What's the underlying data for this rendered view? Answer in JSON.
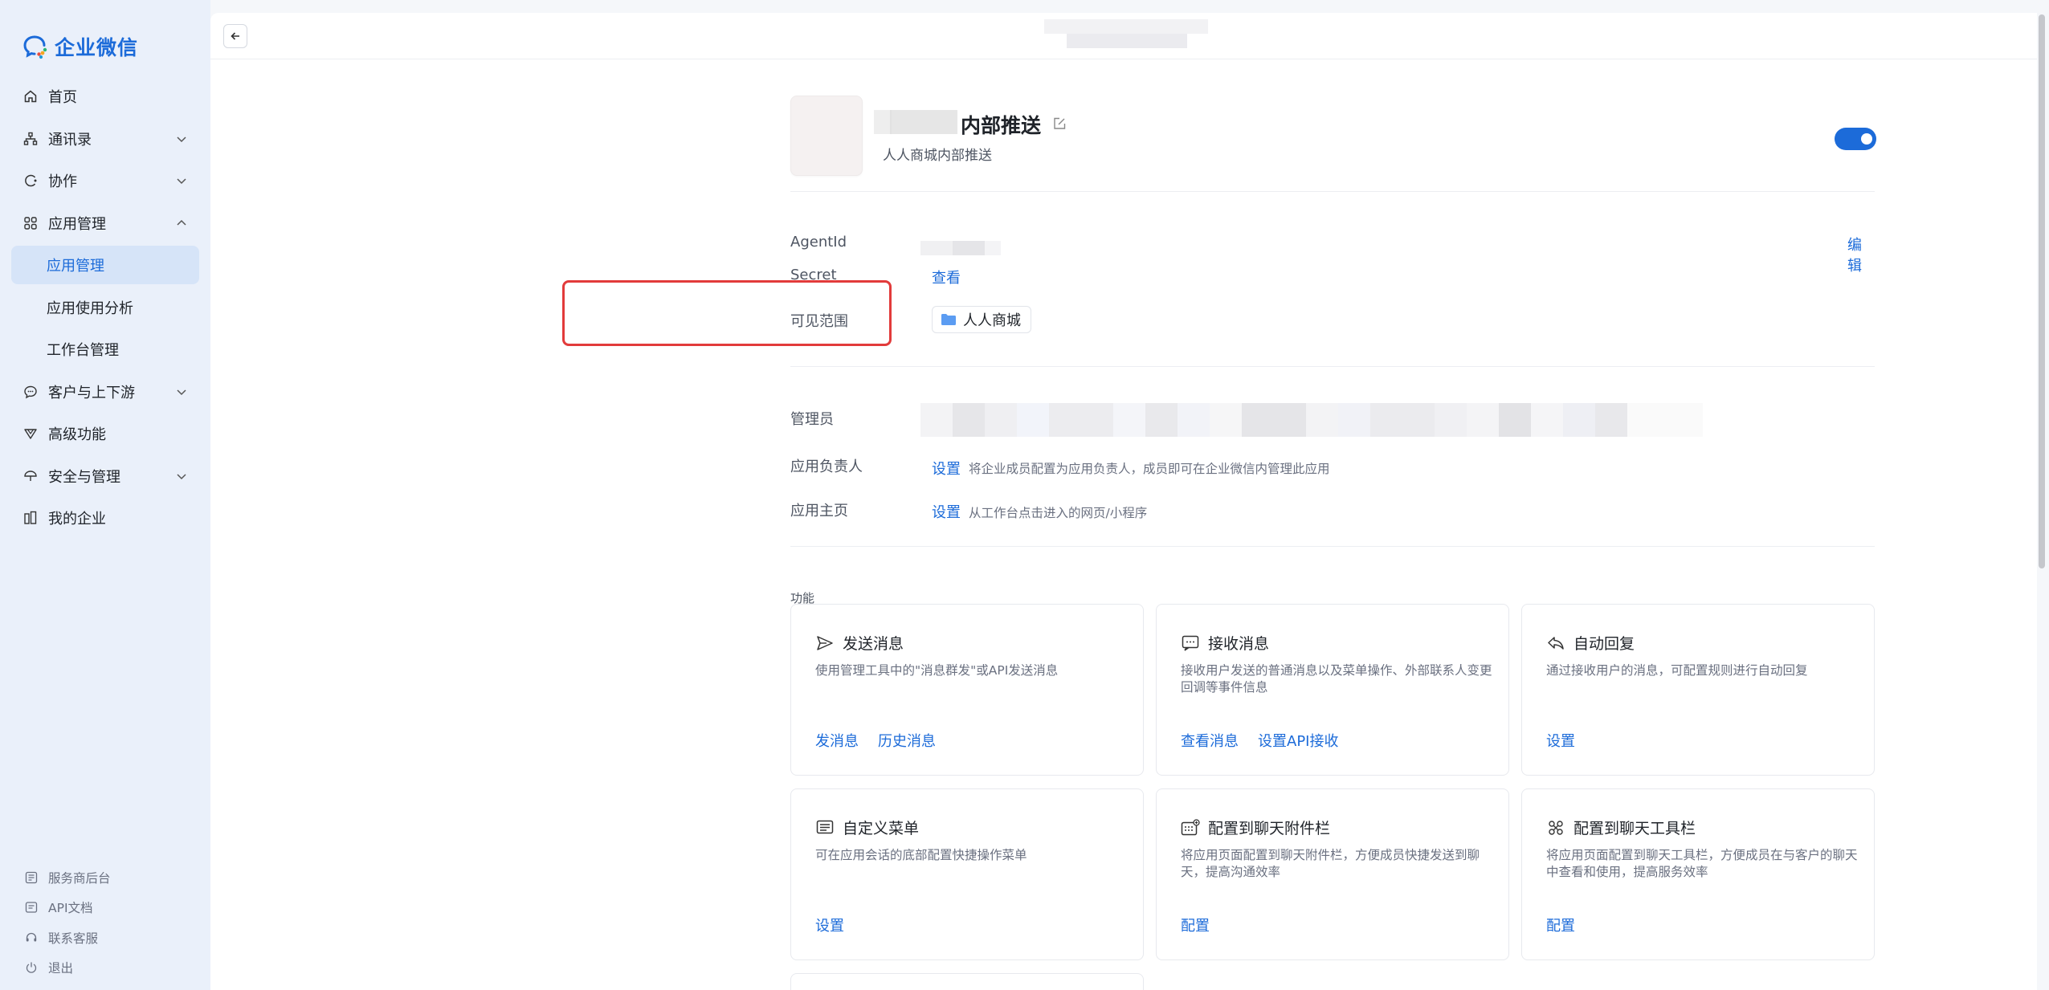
{
  "brand": {
    "name": "企业微信"
  },
  "sidebar": {
    "items": [
      {
        "label": "首页",
        "icon": "home-icon"
      },
      {
        "label": "通讯录",
        "icon": "org-chart-icon",
        "expand": "chevron-down-icon"
      },
      {
        "label": "协作",
        "icon": "collab-icon",
        "expand": "chevron-down-icon"
      },
      {
        "label": "应用管理",
        "icon": "apps-grid-icon",
        "expand": "chevron-up-icon"
      },
      {
        "label": "应用管理",
        "sub": true,
        "active": true
      },
      {
        "label": "应用使用分析",
        "sub": true
      },
      {
        "label": "工作台管理",
        "sub": true
      },
      {
        "label": "客户与上下游",
        "icon": "chat-bubble-icon",
        "expand": "chevron-down-icon"
      },
      {
        "label": "高级功能",
        "icon": "diamond-icon"
      },
      {
        "label": "安全与管理",
        "icon": "umbrella-icon",
        "expand": "chevron-down-icon"
      },
      {
        "label": "我的企业",
        "icon": "building-icon"
      }
    ],
    "footer": [
      {
        "label": "服务商后台",
        "icon": "grid-icon"
      },
      {
        "label": "API文档",
        "icon": "doc-icon"
      },
      {
        "label": "联系客服",
        "icon": "headset-icon"
      },
      {
        "label": "退出",
        "icon": "power-icon"
      }
    ]
  },
  "app": {
    "name_visible": "内部推送",
    "description": "人人商城内部推送",
    "enabled": true
  },
  "details": {
    "agentid_label": "AgentId",
    "edit_link": "编辑",
    "secret_label": "Secret",
    "secret_link": "查看",
    "scope_label": "可见范围",
    "scope_value": "人人商城",
    "admin_label": "管理员",
    "owner_label": "应用负责人",
    "owner_link": "设置",
    "owner_hint": "将企业成员配置为应用负责人，成员即可在企业微信内管理此应用",
    "homepage_label": "应用主页",
    "homepage_link": "设置",
    "homepage_hint": "从工作台点击进入的网页/小程序"
  },
  "features": {
    "title": "功能",
    "cards": [
      {
        "title": "发送消息",
        "icon": "send-icon",
        "desc": "使用管理工具中的\"消息群发\"或API发送消息",
        "links": [
          "发消息",
          "历史消息"
        ]
      },
      {
        "title": "接收消息",
        "icon": "message-icon",
        "desc": "接收用户发送的普通消息以及菜单操作、外部联系人变更回调等事件信息",
        "links": [
          "查看消息",
          "设置API接收"
        ]
      },
      {
        "title": "自动回复",
        "icon": "reply-icon",
        "desc": "通过接收用户的消息，可配置规则进行自动回复",
        "links": [
          "设置"
        ]
      },
      {
        "title": "自定义菜单",
        "icon": "menu-icon",
        "desc": "可在应用会话的底部配置快捷操作菜单",
        "links": [
          "设置"
        ]
      },
      {
        "title": "配置到聊天附件栏",
        "icon": "attachment-bar-icon",
        "desc": "将应用页面配置到聊天附件栏，方便成员快捷发送到聊天，提高沟通效率",
        "links": [
          "配置"
        ]
      },
      {
        "title": "配置到聊天工具栏",
        "icon": "toolbar-icon",
        "desc": "将应用页面配置到聊天工具栏，方便成员在与客户的聊天中查看和使用，提高服务效率",
        "links": [
          "配置"
        ]
      }
    ]
  },
  "colors": {
    "accent": "#1c6bd9",
    "sidebar_bg": "#eaf0fa",
    "highlight": "#e23b3b"
  }
}
